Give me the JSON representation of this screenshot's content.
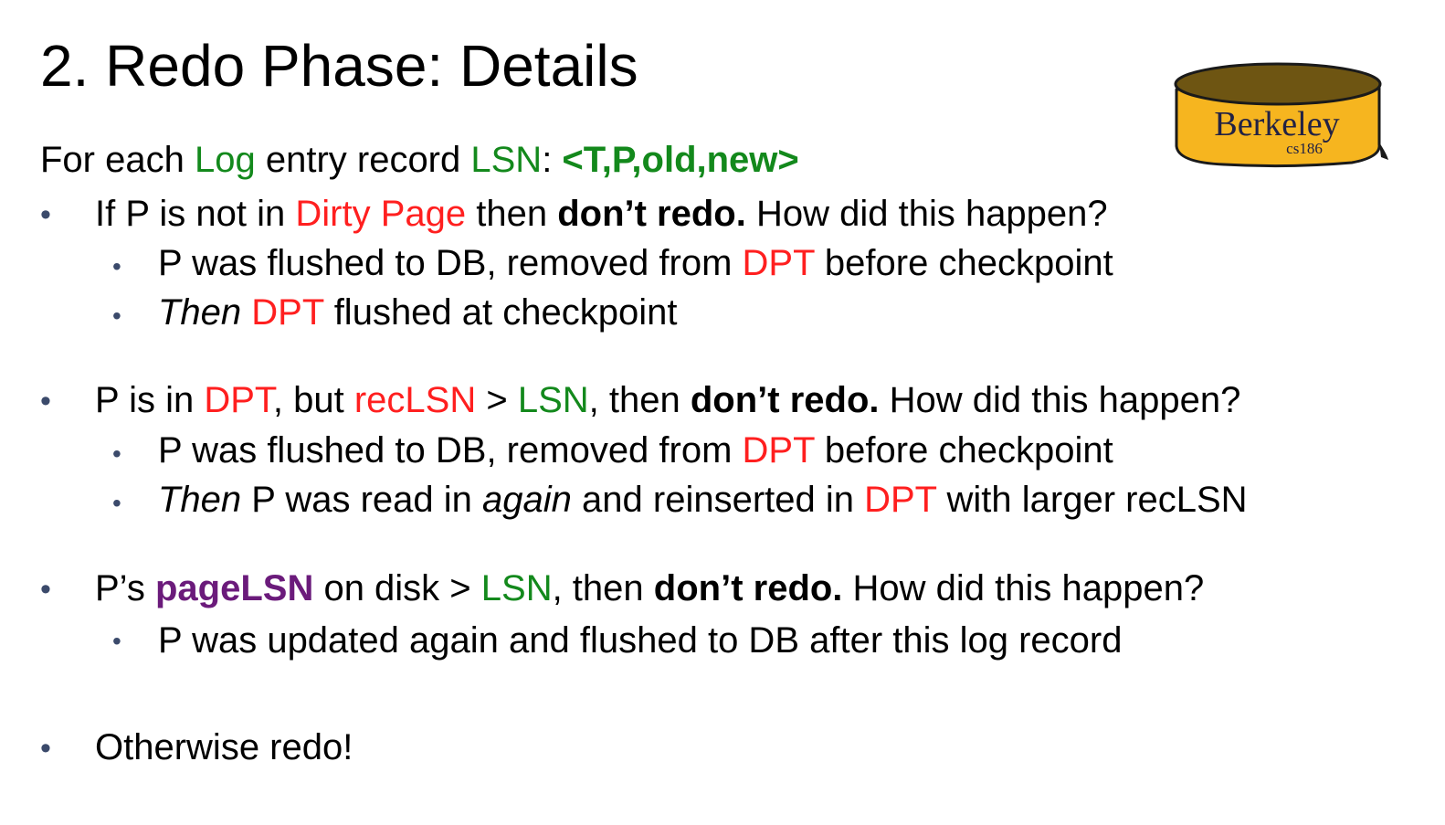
{
  "title": "2. Redo Phase: Details",
  "intro": {
    "t1": "For each ",
    "log": "Log",
    "t2": " entry record ",
    "lsn": "LSN",
    "t3": ": ",
    "tuple": "<T,P,old,new>"
  },
  "bullets": [
    {
      "parts": {
        "a": "If P is not in ",
        "b": "Dirty Page",
        "c": " then ",
        "d": "don’t redo.",
        "e": " How did this happen?"
      },
      "subs": [
        {
          "a": "P was flushed to DB, removed from ",
          "b": "DPT",
          "c": " before checkpoint"
        },
        {
          "a": "Then",
          "b": " ",
          "c": "DPT",
          "d": " flushed at checkpoint"
        }
      ]
    },
    {
      "parts": {
        "a": "P is in ",
        "b": "DPT",
        "c": ", but ",
        "d": "recLSN",
        "e": " > ",
        "f": "LSN",
        "g": ", then ",
        "h": "don’t redo.",
        "i": " How did this happen?"
      },
      "subs": [
        {
          "a": "P was flushed to DB, removed from ",
          "b": "DPT",
          "c": " before checkpoint"
        },
        {
          "a": "Then",
          "b": " P was read in ",
          "c": "again",
          "d": " and reinserted in ",
          "e": "DPT",
          "f": " with larger recLSN"
        }
      ]
    },
    {
      "parts": {
        "a": "P’s ",
        "b": "pageLSN",
        "c": " on disk > ",
        "d": "LSN",
        "e": ", then ",
        "f": "don’t redo.",
        "g": " How did this happen?"
      },
      "subs": [
        {
          "a": "P was updated again and flushed to DB after this log record"
        }
      ]
    },
    {
      "parts": {
        "a": "Otherwise redo!"
      }
    }
  ],
  "bullet_glyph": "•",
  "logo": {
    "name": "Berkeley",
    "course": "cs186"
  },
  "colors": {
    "red": "#ff1f1f",
    "green": "#13891c",
    "purple": "#6b1b7b",
    "bullet": "#3b4a6b",
    "logo_fill": "#f6b51f",
    "logo_rim": "#6e5512"
  }
}
